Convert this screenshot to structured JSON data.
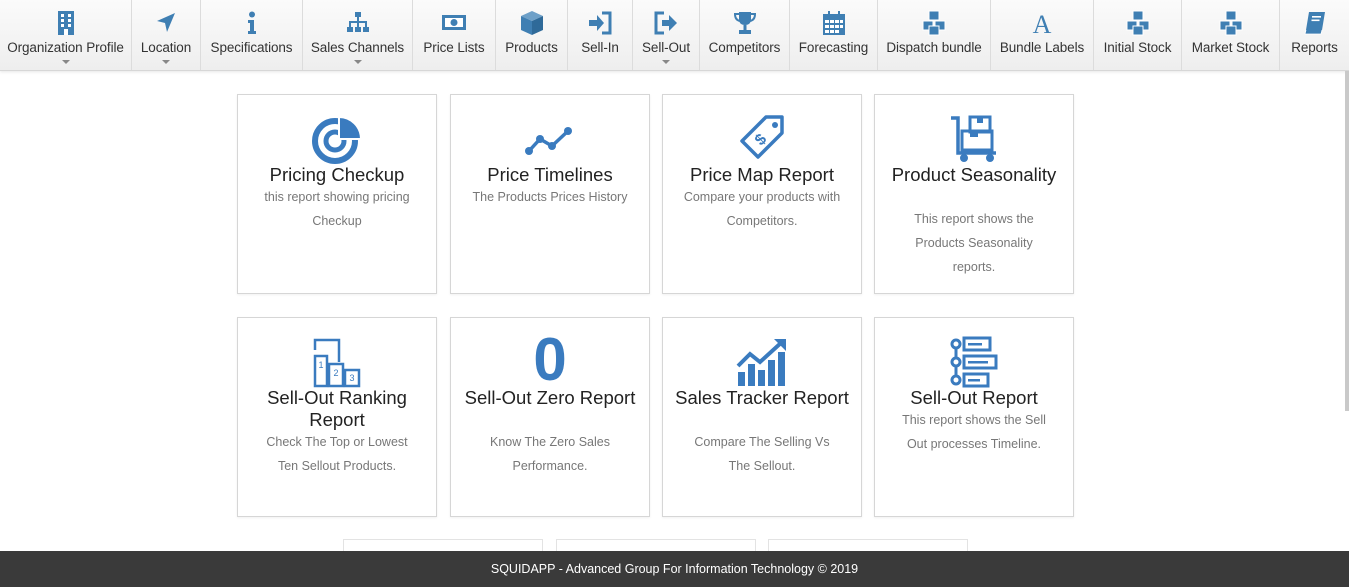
{
  "colors": {
    "accent": "#3a7bbf",
    "nav_icon": "#3f7fb3",
    "footer_bg": "#3a3a3a",
    "card_desc": "#777777"
  },
  "nav": [
    {
      "label": "Organization Profile",
      "icon": "building-icon",
      "has_dropdown": true
    },
    {
      "label": "Location",
      "icon": "location-arrow-icon",
      "has_dropdown": true
    },
    {
      "label": "Specifications",
      "icon": "info-icon",
      "has_dropdown": false
    },
    {
      "label": "Sales Channels",
      "icon": "sitemap-icon",
      "has_dropdown": true
    },
    {
      "label": "Price Lists",
      "icon": "money-bill-icon",
      "has_dropdown": false
    },
    {
      "label": "Products",
      "icon": "cube-icon",
      "has_dropdown": false
    },
    {
      "label": "Sell-In",
      "icon": "sign-in-icon",
      "has_dropdown": false
    },
    {
      "label": "Sell-Out",
      "icon": "sign-out-icon",
      "has_dropdown": true
    },
    {
      "label": "Competitors",
      "icon": "trophy-icon",
      "has_dropdown": false
    },
    {
      "label": "Forecasting",
      "icon": "calendar-icon",
      "has_dropdown": false
    },
    {
      "label": "Dispatch bundle",
      "icon": "cubes-icon",
      "has_dropdown": false
    },
    {
      "label": "Bundle Labels",
      "icon": "font-icon",
      "has_dropdown": false
    },
    {
      "label": "Initial Stock",
      "icon": "cubes-icon",
      "has_dropdown": false
    },
    {
      "label": "Market Stock",
      "icon": "cubes-icon",
      "has_dropdown": false
    },
    {
      "label": "Reports",
      "icon": "book-icon",
      "has_dropdown": false
    }
  ],
  "cards": [
    {
      "title": "Pricing Checkup",
      "desc": "this report showing pricing Checkup",
      "icon": "pie-chart-icon"
    },
    {
      "title": "Price Timelines",
      "desc": "The Products Prices History",
      "icon": "line-chart-icon"
    },
    {
      "title": "Price Map Report",
      "desc": "Compare your products with Competitors.",
      "icon": "price-tag-icon"
    },
    {
      "title": "Product Seasonality",
      "desc": "This report shows the Products Seasonality reports.",
      "icon": "dolly-cart-icon"
    },
    {
      "title": "Sell-Out Ranking Report",
      "desc": "Check The Top or Lowest Ten Sellout Products.",
      "icon": "ranking-podium-icon"
    },
    {
      "title": "Sell-Out Zero Report",
      "desc": "Know The Zero Sales Performance.",
      "icon": "zero-icon",
      "glyph": "0"
    },
    {
      "title": "Sales Tracker Report",
      "desc": "Compare The Selling Vs The Sellout.",
      "icon": "trending-chart-icon"
    },
    {
      "title": "Sell-Out Report",
      "desc": "This report shows the Sell Out processes Timeline.",
      "icon": "timeline-icon"
    }
  ],
  "footer": {
    "text": "SQUIDAPP - Advanced Group For Information Technology © 2019"
  }
}
